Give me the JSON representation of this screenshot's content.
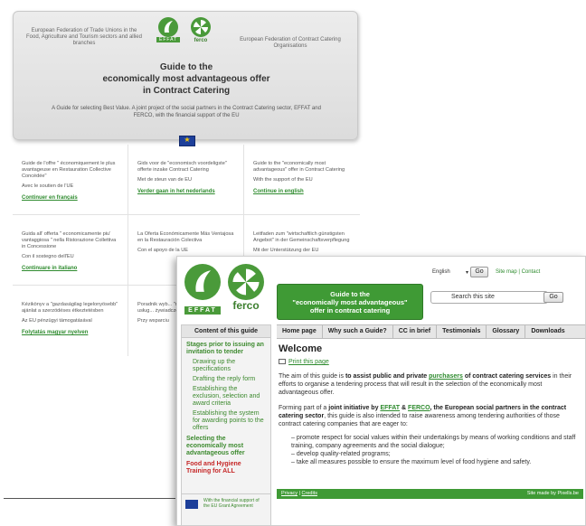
{
  "header": {
    "fed_left": "European Federation of Trade Unions in the Food, Agriculture and Tourism sectors and allied branches",
    "fed_right": "European Federation of Contract Catering Organisations",
    "logo_effat": "EFFAT",
    "logo_ferco": "ferco",
    "title_line1": "Guide to the",
    "title_line2": "economically most advantageous offer",
    "title_line3": "in Contract Catering",
    "subtitle": "A Guide for selecting Best Value. A joint project of the social partners in the Contract Catering sector, EFFAT and FERCO, with the financial support of the EU"
  },
  "languages": [
    {
      "desc": "Guide de l'offre \" économiquement le plus avantageuse en Restauration Collective Concédée\"",
      "support": "Avec le soutien de l'UE",
      "link": "Continuer en français"
    },
    {
      "desc": "Gids voor de \"economisch voordeligste\" offerte inzake Contract Catering",
      "support": "Met de steun van de EU",
      "link": "Verder gaan in het nederlands"
    },
    {
      "desc": "Guide to the \"economically most advantageous\" offer in Contract Catering",
      "support": "With the support of the EU",
      "link": "Continue in english"
    },
    {
      "desc": "Guida all' offerta \" economicamente piu' vantaggiosa \" nella Ristorazione Collettiva in Concessione",
      "support": "Con il sostegno dell'EU",
      "link": "Continuare in italiano"
    },
    {
      "desc": "La Oferta Económicamente Más Ventajosa en la Restauración Colectiva",
      "support": "Con el apoyo de la UE",
      "link": ""
    },
    {
      "desc": "Leitfaden zum \"wirtschaftlich günstigsten Angebot\" in der Gemeinschaftsverpflegung",
      "support": "Mit der Unterstützung der EU",
      "link": ""
    },
    {
      "desc": "Kézikönyv a \"gazdaságilag legelonyösebb\" ajánlat a szerzödéses étkeztetésben",
      "support": "Az EU pénzügyi támogatásával",
      "link": "Folytatás magyar nyelven"
    },
    {
      "desc": "Poradnik wyb... \"najkorzystne... sposród usług... żywiadczonych",
      "support": "Przy wsparciu",
      "link": ""
    }
  ],
  "site": {
    "banner_line1": "Guide to the",
    "banner_line2": "\"economically most advantageous\"",
    "banner_line3": "offer in contract catering",
    "lang_value": "English",
    "go_label": "Go",
    "site_map": "Site map",
    "contact": "Contact",
    "search_value": "Search this site",
    "nav": [
      "Home page",
      "Why such a Guide?",
      "CC in brief",
      "Testimonials",
      "Glossary",
      "Downloads"
    ],
    "sidebar": {
      "head": "Content of this guide",
      "section1": "Stages prior to issuing an invitation to tender",
      "sub": [
        "Drawing up the specifications",
        "Drafting the reply form",
        "Establishing the exclusion, selection and award criteria",
        "Establishing the system for awarding points to the offers"
      ],
      "section2": "Selecting the economically most advantageous offer",
      "section3": "Food and Hygiene Training for ALL",
      "eu_text": "With the financial support of the EU Grant Agreement"
    },
    "main": {
      "welcome": "Welcome",
      "print": "Print this page",
      "p1_a": "The aim of this guide is ",
      "p1_b": "to assist public and private ",
      "p1_link": "purchasers",
      "p1_c": " of contract catering services",
      "p1_d": " in their efforts to organise a tendering process that will result in the selection of the economically most advantageous offer.",
      "p2_a": "Forming part of a ",
      "p2_b": "joint initiative by ",
      "p2_link1": "EFFAT",
      "p2_amp": " & ",
      "p2_link2": "FERCO",
      "p2_c": ", the European social partners in the contract catering sector",
      "p2_d": ", this guide is also intended to raise awareness among tendering authorities of those contract catering companies that are eager to:",
      "bullets": [
        "promote respect for social values within their undertakings by means of working conditions and staff training, company agreements and the social dialogue;",
        "develop quality-related programs;",
        "take all measures possible to ensure the maximum level of food hygiene and safety."
      ]
    },
    "footer": {
      "privacy": "Privacy",
      "credits": "Credits",
      "made_by": "Site made by Pixells.be"
    }
  }
}
